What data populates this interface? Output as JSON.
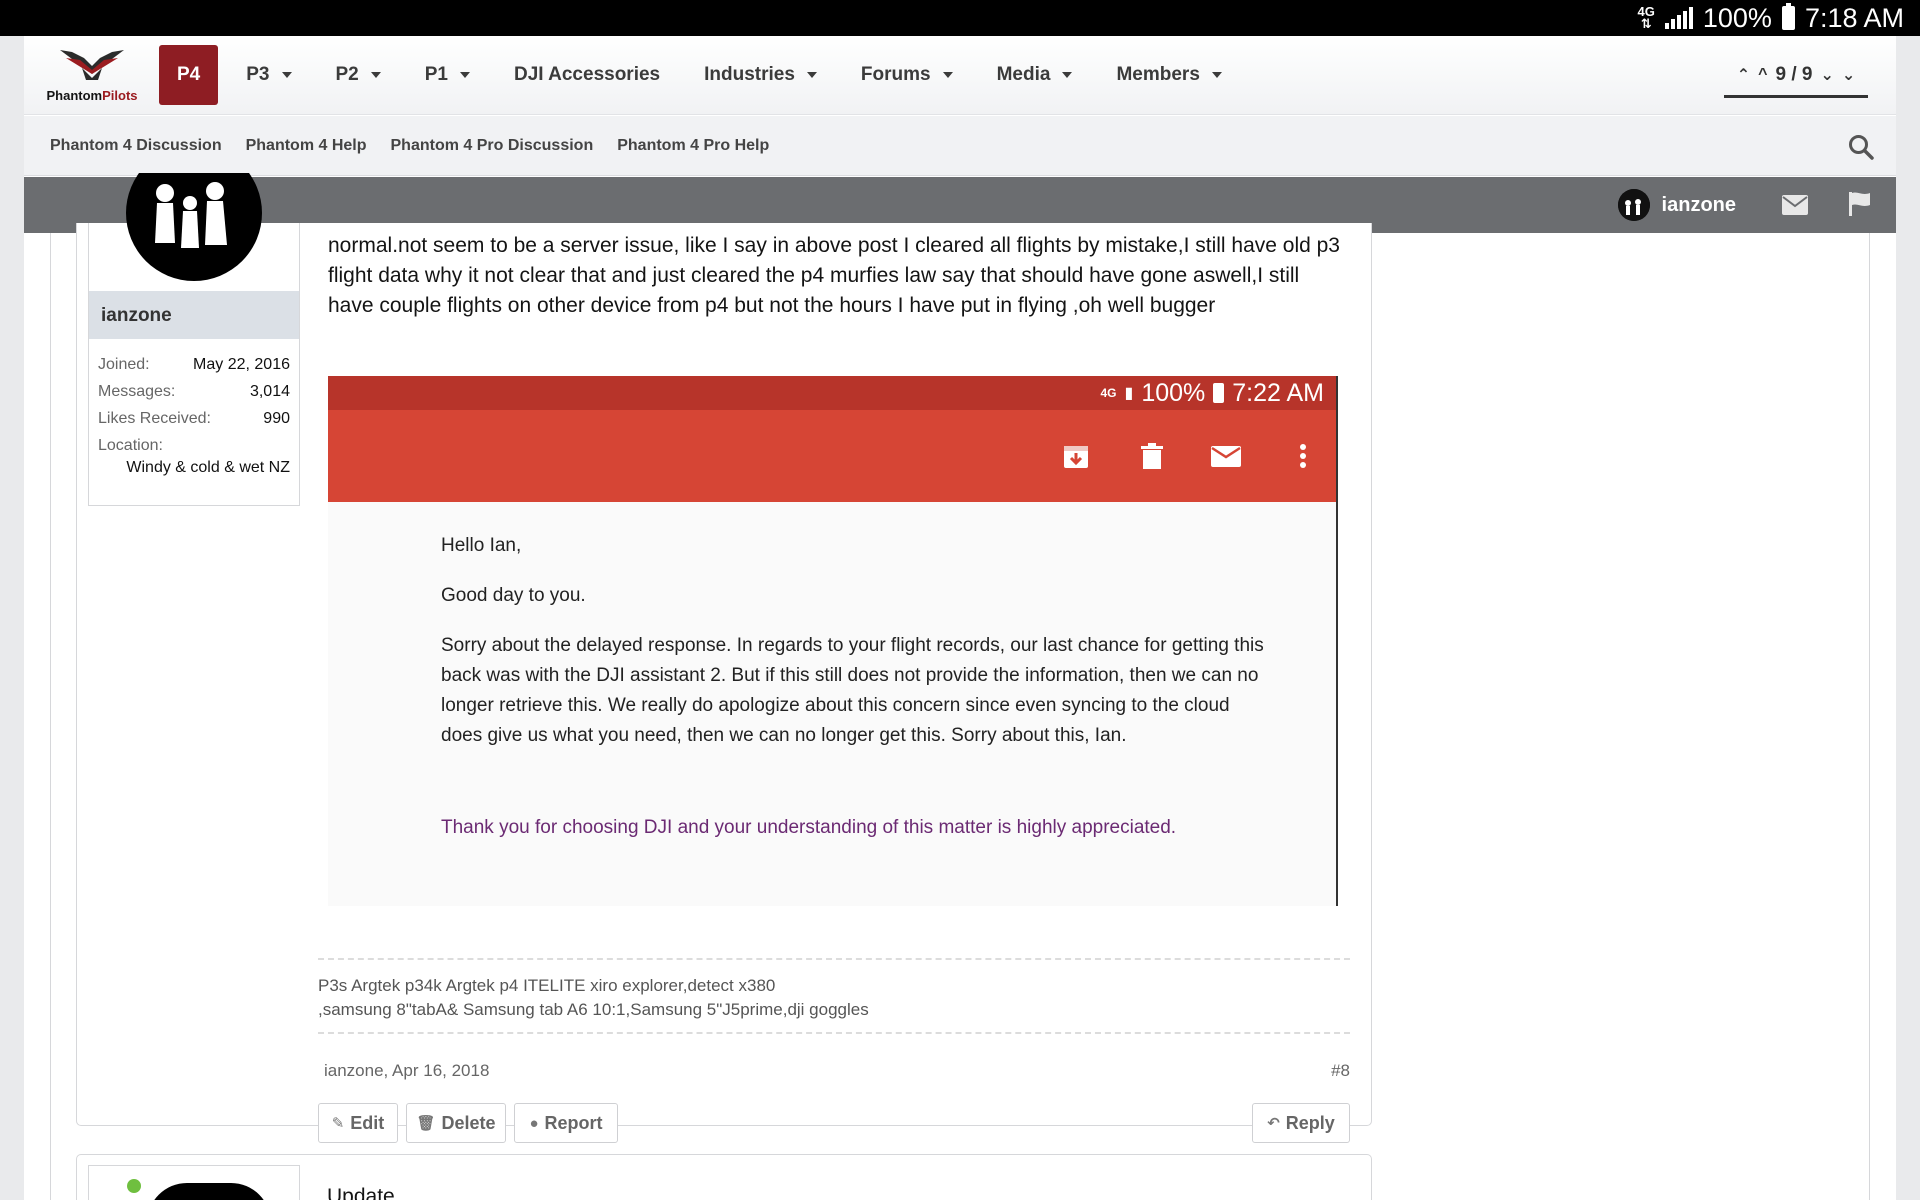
{
  "status_bar": {
    "network": "4G",
    "battery": "100%",
    "time": "7:18 AM"
  },
  "site": {
    "logo_text_a": "Phantom",
    "logo_text_b": "Pilots"
  },
  "nav": {
    "items": [
      {
        "label": "P4",
        "active": true,
        "dropdown": false
      },
      {
        "label": "P3",
        "dropdown": true
      },
      {
        "label": "P2",
        "dropdown": true
      },
      {
        "label": "P1",
        "dropdown": true
      },
      {
        "label": "DJI Accessories",
        "dropdown": false
      },
      {
        "label": "Industries",
        "dropdown": true
      },
      {
        "label": "Forums",
        "dropdown": true
      },
      {
        "label": "Media",
        "dropdown": true
      },
      {
        "label": "Members",
        "dropdown": true
      }
    ],
    "pager": "9 / 9"
  },
  "subnav": {
    "items": [
      "Phantom 4 Discussion",
      "Phantom 4 Help",
      "Phantom 4 Pro Discussion",
      "Phantom 4 Pro Help"
    ]
  },
  "userbar": {
    "username": "ianzone"
  },
  "post": {
    "author": {
      "name": "ianzone",
      "stats": [
        {
          "label": "Joined:",
          "value": "May 22, 2016"
        },
        {
          "label": "Messages:",
          "value": "3,014"
        },
        {
          "label": "Likes Received:",
          "value": "990"
        },
        {
          "label": "Location:",
          "value": ""
        }
      ],
      "location": "Windy & cold & wet NZ"
    },
    "text": "normal.not seem to be a server issue, like I say in above post I cleared all flights by mistake,I still have old p3 flight data why it not clear that and just cleared the p4 murfies law say that should have gone aswell,I still have couple flights on other device from p4 but not the hours I have put in flying ,oh well bugger",
    "screenshot": {
      "network": "4G",
      "battery": "100%",
      "time": "7:22 AM",
      "greeting": "Hello Ian,",
      "line2": "Good day to you.",
      "body": "Sorry about the delayed response. In regards to your flight records, our last chance for getting this back was with the DJI assistant 2. But if this still does not provide the information, then we can no longer retrieve this. We really do apologize about this concern since even syncing to the cloud does give us what you need, then we can no longer get this. Sorry about this, Ian.",
      "thanks": "Thank you for choosing DJI and your understanding of this matter is highly appreciated.",
      "colors": {
        "status": "#b7342a",
        "toolbar": "#d64535",
        "thanks": "#6b2a73"
      }
    },
    "signature_line1": "P3s Argtek p34k Argtek p4 ITELITE xiro explorer,detect x380",
    "signature_line2": ",samsung 8\"tabA& Samsung tab A6 10:1,Samsung 5\"J5prime,dji goggles",
    "meta_author_date": "ianzone, Apr 16, 2018",
    "post_number": "#8",
    "actions": {
      "edit": "Edit",
      "delete": "Delete",
      "report": "Report",
      "reply": "Reply"
    }
  },
  "next_post": {
    "title": "Update"
  },
  "colors": {
    "accent": "#8e1d23",
    "userbar": "#6b6d70",
    "online": "#6fbf3f"
  }
}
